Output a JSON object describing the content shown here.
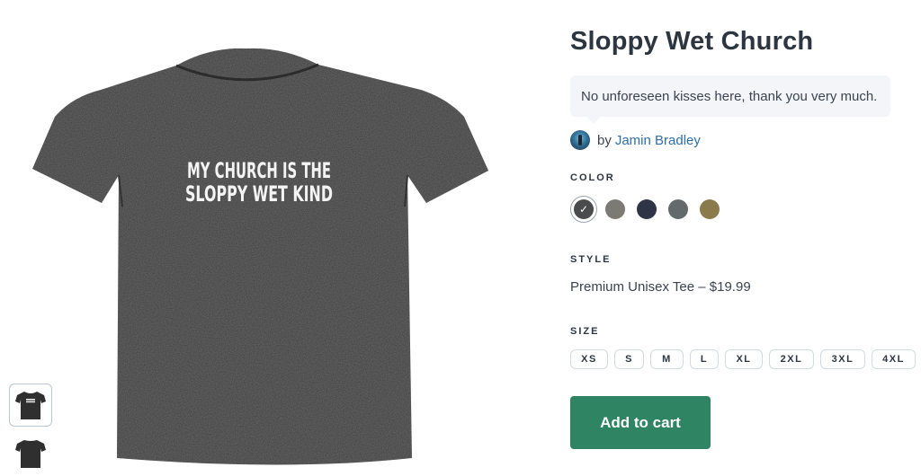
{
  "product": {
    "title": "Sloppy Wet Church",
    "tagline": "No unforeseen kisses here, thank you very much.",
    "byline_prefix": "by",
    "author": "Jamin Bradley",
    "shirt_print_lines": [
      "MY CHURCH IS THE",
      "SLOPPY WET KIND"
    ],
    "shirt_color": "#3a3a3b"
  },
  "color_section": {
    "label": "COLOR",
    "swatches": [
      {
        "name": "charcoal",
        "hex": "#4a4b4d",
        "selected": true
      },
      {
        "name": "gray",
        "hex": "#7b7a74",
        "selected": false
      },
      {
        "name": "navy",
        "hex": "#2f3547",
        "selected": false
      },
      {
        "name": "slate",
        "hex": "#64696b",
        "selected": false
      },
      {
        "name": "olive",
        "hex": "#8a7a4c",
        "selected": false
      }
    ]
  },
  "style_section": {
    "label": "STYLE",
    "value": "Premium Unisex Tee – $19.99"
  },
  "size_section": {
    "label": "SIZE",
    "sizes": [
      "XS",
      "S",
      "M",
      "L",
      "XL",
      "2XL",
      "3XL",
      "4XL"
    ]
  },
  "cart": {
    "label": "Add to cart",
    "color": "#2e8463"
  }
}
